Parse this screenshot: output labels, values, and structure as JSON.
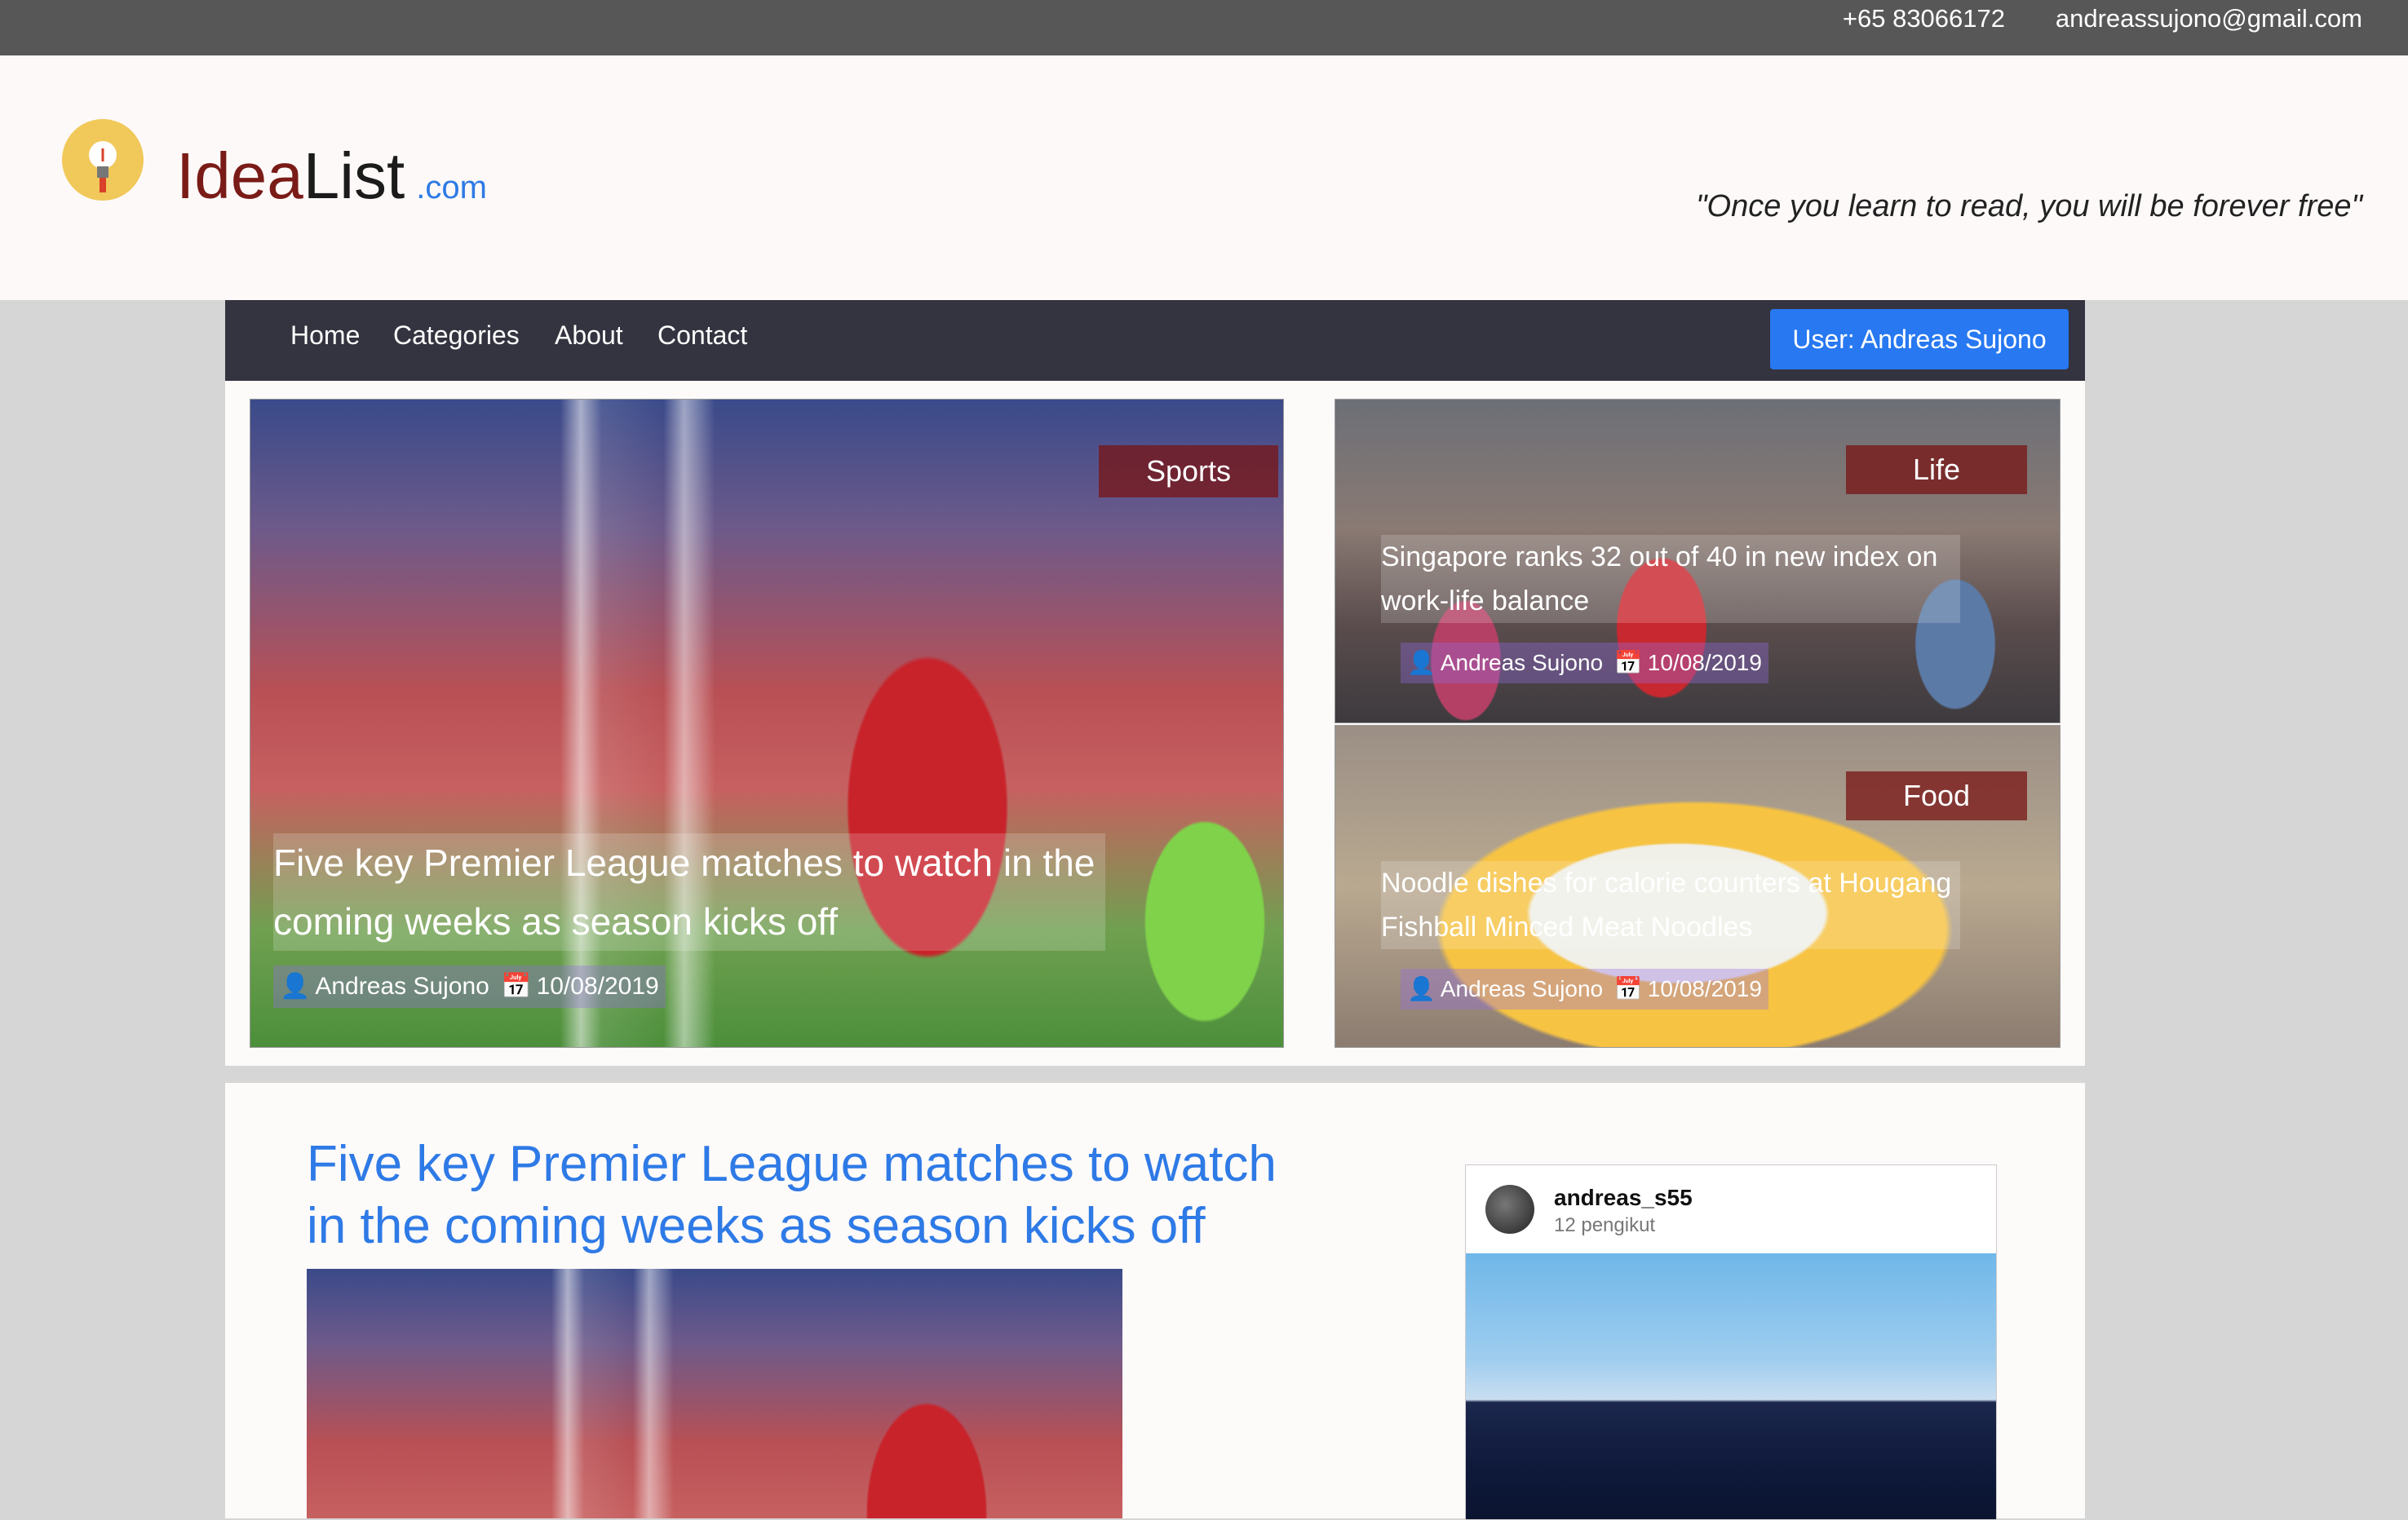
{
  "topbar": {
    "phone": "+65 83066172",
    "email": "andreassujono@gmail.com"
  },
  "brand": {
    "name_part1": "Idea",
    "name_part2": "List",
    "suffix": ".com",
    "logo_icon": "lightbulb-icon"
  },
  "quote": "\"Once you learn to read, you will be forever free\"",
  "nav": {
    "items": [
      "Home",
      "Categories",
      "About",
      "Contact"
    ],
    "user_button": "User: Andreas Sujono"
  },
  "featured": [
    {
      "category": "Sports",
      "title": "Five key Premier League matches to watch in the coming weeks as season kicks off",
      "author": "Andreas Sujono",
      "date": "10/08/2019"
    },
    {
      "category": "Life",
      "title": "Singapore ranks 32 out of 40 in new index on work-life balance",
      "author": "Andreas Sujono",
      "date": "10/08/2019"
    },
    {
      "category": "Food",
      "title": "Noodle dishes for calorie counters at Hougang Fishball Minced Meat Noodles",
      "author": "Andreas Sujono",
      "date": "10/08/2019"
    }
  ],
  "article": {
    "title": "Five key Premier League matches to watch in the coming weeks as season kicks off"
  },
  "instagram": {
    "username": "andreas_s55",
    "followers": "12 pengikut"
  },
  "colors": {
    "topbar": "#575757",
    "navbar": "#343440",
    "accent": "#2778f1",
    "brand_red": "#7a1b17"
  },
  "icons": {
    "author": "user-icon",
    "date": "calendar-icon"
  }
}
